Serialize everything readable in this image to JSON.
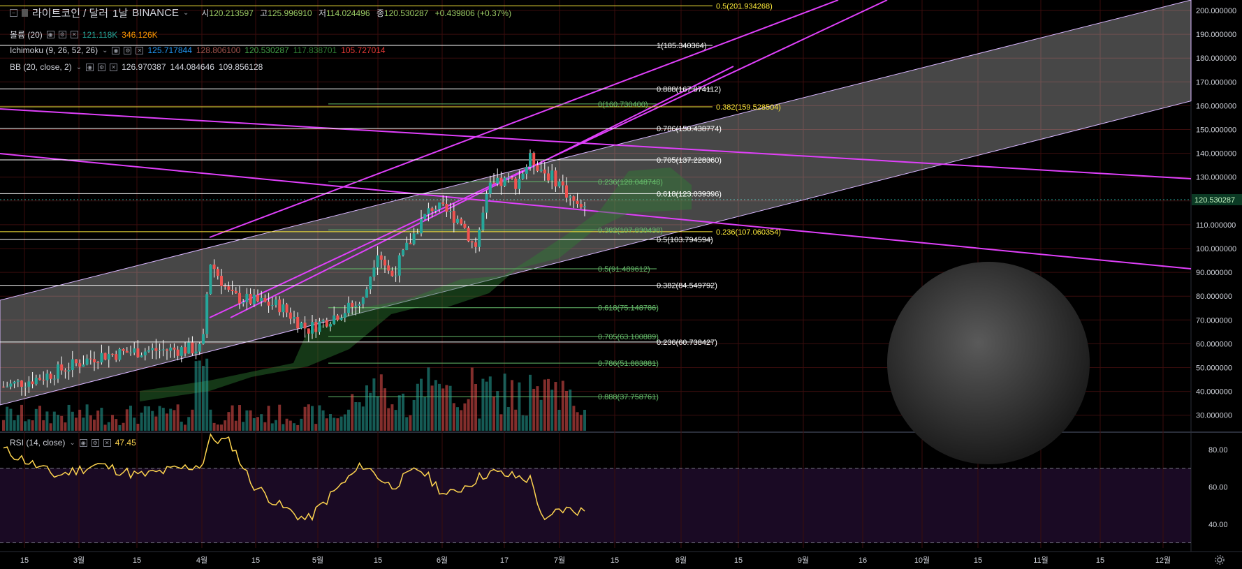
{
  "header": {
    "symbol": "라이트코인 / 달러",
    "interval": "1날",
    "exchange": "BINANCE",
    "open_label": "시",
    "open": "120.213597",
    "high_label": "고",
    "high": "125.996910",
    "low_label": "저",
    "low": "114.024496",
    "close_label": "종",
    "close": "120.530287",
    "change": "+0.439806 (+0.37%)"
  },
  "indicators": {
    "volume": {
      "name": "볼륨 (20)",
      "v1": "121.118K",
      "v2": "346.126K"
    },
    "ichimoku": {
      "name": "Ichimoku (9, 26, 52, 26)",
      "v1": "125.717844",
      "v2": "128.806100",
      "v3": "120.530287",
      "v4": "117.838701",
      "v5": "105.727014"
    },
    "bb": {
      "name": "BB (20, close, 2)",
      "v1": "126.970387",
      "v2": "144.084646",
      "v3": "109.856128"
    },
    "rsi": {
      "name": "RSI (14, close)",
      "value": "47.45"
    }
  },
  "colors": {
    "background": "#000000",
    "up": "#26a69a",
    "down": "#ef5350",
    "magenta": "#e040fb",
    "channel": "#bdbdbd",
    "rsi": "#ffd54f",
    "fib_green": "#66bb6a",
    "fib_white": "#ffffff",
    "fib_yellow": "#ffeb3b",
    "ichimoku_green": "#2e7d32",
    "ichimoku_red": "#b71c1c"
  },
  "price_axis": {
    "ticks": [
      "200.000000",
      "190.000000",
      "180.000000",
      "170.000000",
      "160.000000",
      "150.000000",
      "140.000000",
      "130.000000",
      "120.000000",
      "110.000000",
      "100.000000",
      "90.000000",
      "80.000000",
      "70.000000",
      "60.000000",
      "50.000000",
      "40.000000",
      "30.000000"
    ],
    "current_price": "120.530287"
  },
  "rsi_axis": {
    "ticks": [
      "80.00",
      "60.00",
      "40.00"
    ]
  },
  "time_axis": {
    "labels": [
      "15",
      "3월",
      "15",
      "4월",
      "15",
      "5월",
      "15",
      "6월",
      "17",
      "7월",
      "15",
      "8월",
      "15",
      "9월",
      "16",
      "10월",
      "15",
      "11월",
      "15",
      "12월"
    ]
  },
  "fib_white": [
    {
      "label": "0.5(201.934268)",
      "color": "yellow",
      "price": 201.934268
    },
    {
      "label": "1(185.340364)",
      "color": "white",
      "price": 185.340364
    },
    {
      "label": "0.888(167.074112)",
      "color": "white",
      "price": 167.074112
    },
    {
      "label": "0.786(150.438774)",
      "color": "white",
      "price": 150.438774
    },
    {
      "label": "0.705(137.228360)",
      "color": "white",
      "price": 137.22836
    },
    {
      "label": "0.618(123.039396)",
      "color": "white",
      "price": 123.039396
    },
    {
      "label": "0.5(103.794594)",
      "color": "white",
      "price": 103.794594
    },
    {
      "label": "0.382(84.549792)",
      "color": "white",
      "price": 84.549792
    },
    {
      "label": "0.236(60.738427)",
      "color": "white",
      "price": 60.738427
    }
  ],
  "fib_yellow": [
    {
      "label": "0.382(159.528504)",
      "price": 159.528504
    },
    {
      "label": "0.236(107.060354)",
      "price": 107.060354
    }
  ],
  "fib_green": [
    {
      "label": "0(160.730400)",
      "price": 160.7304
    },
    {
      "label": "0.236(128.048748)",
      "price": 128.048748
    },
    {
      "label": "0.382(107.830438)",
      "price": 107.830438
    },
    {
      "label": "0.5(91.489612)",
      "price": 91.489612
    },
    {
      "label": "0.618(75.148786)",
      "price": 75.148786
    },
    {
      "label": "0.705(63.100889)",
      "price": 63.100889
    },
    {
      "label": "0.786(51.883881)",
      "price": 51.883881
    },
    {
      "label": "0.888(37.758761)",
      "price": 37.758761
    }
  ]
}
